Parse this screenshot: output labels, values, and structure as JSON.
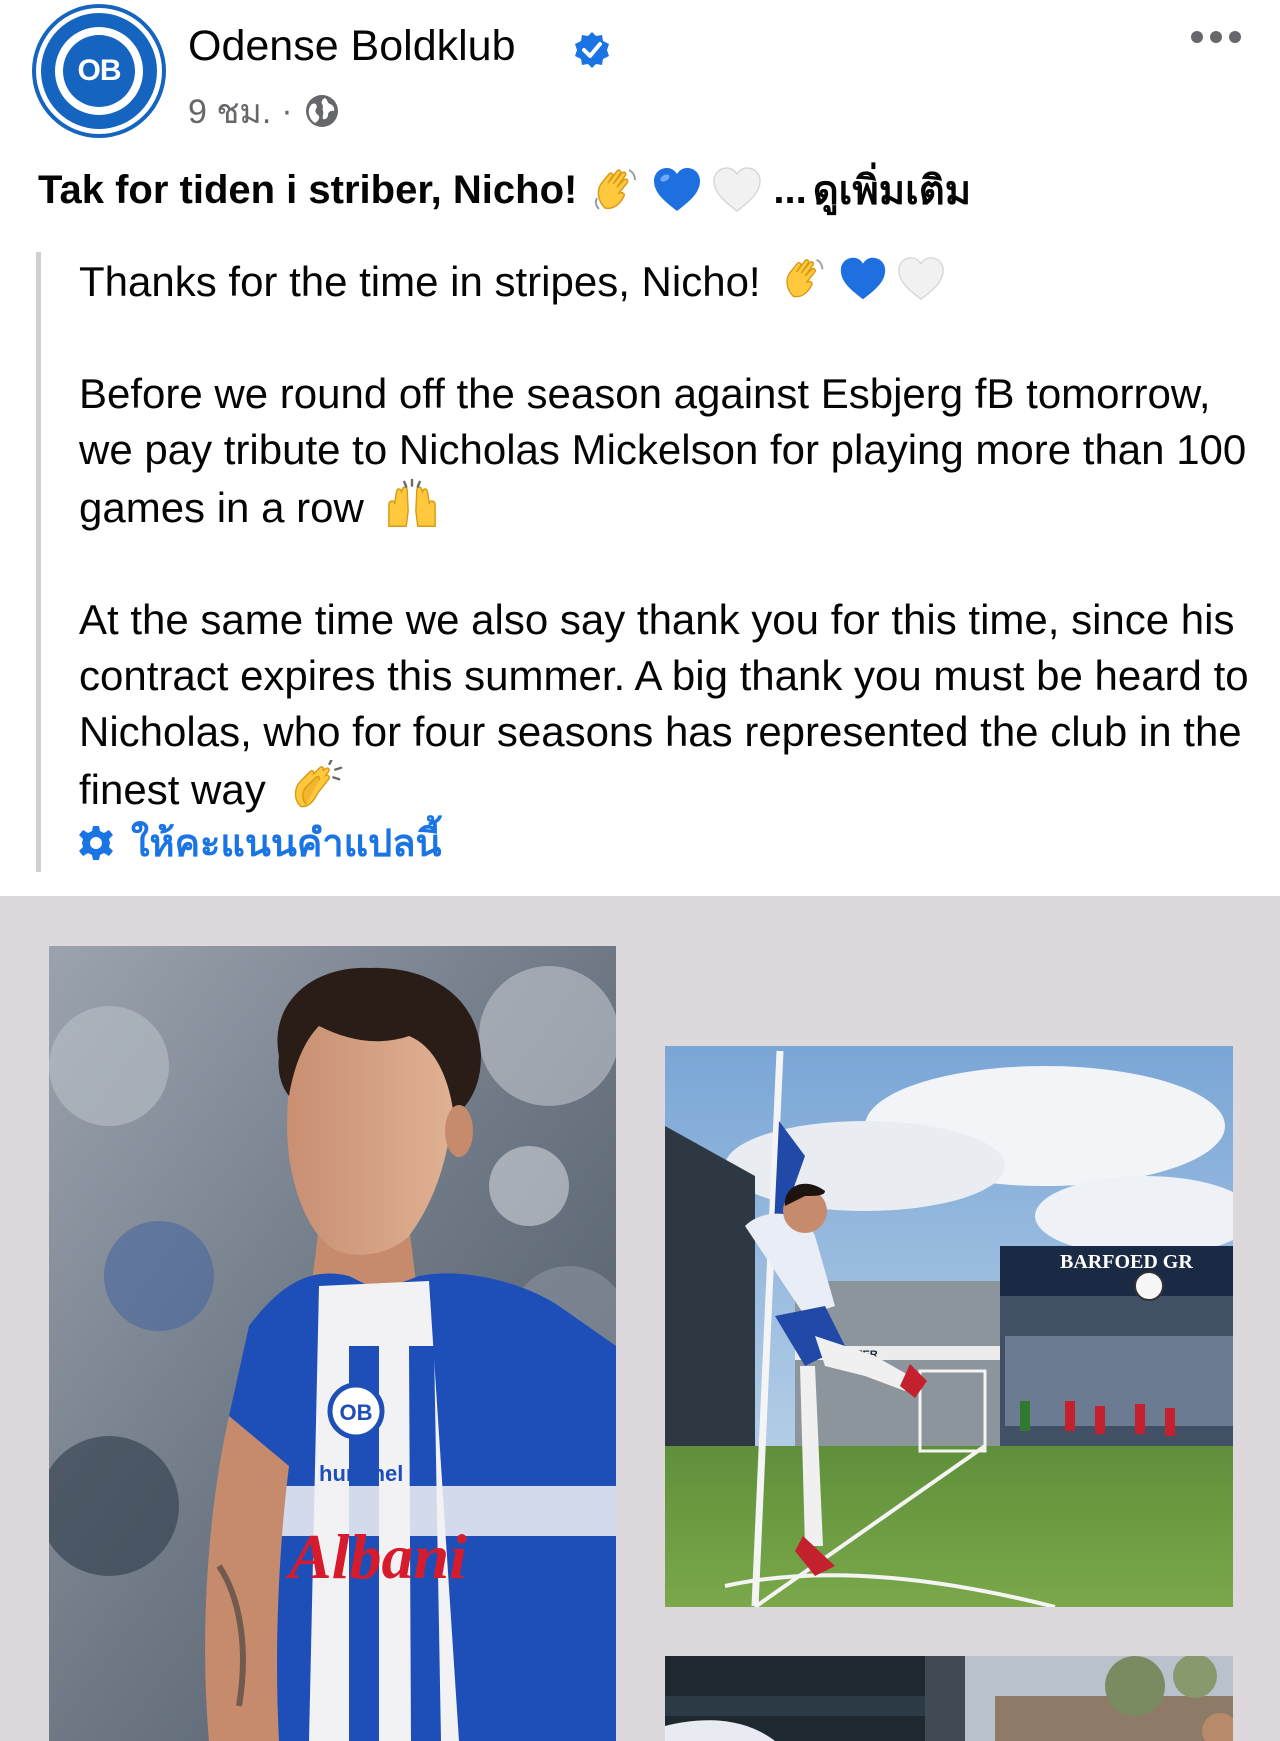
{
  "header": {
    "avatar_text": "OB",
    "page_name": "Odense Boldklub",
    "timestamp": "9 ชม.",
    "separator": "·",
    "privacy_icon": "globe-icon",
    "verified_icon": "verified-badge-icon",
    "more_icon": "more-options-icon"
  },
  "post": {
    "title": "Tak for tiden i striber, Nicho!",
    "title_emojis": [
      "waving-hand-icon",
      "blue-heart-icon",
      "white-heart-icon"
    ],
    "ellipsis": "...",
    "see_more": "ดูเพิ่มเติม"
  },
  "translation": {
    "line1": "Thanks for the time in stripes, Nicho!",
    "para2": "Before we round off the season against Esbjerg fB tomorrow, we pay tribute to Nicholas Mickelson for playing more than 100 games in a row",
    "para3": "At the same time we also say thank you for this time, since his contract expires this summer. A big thank you must be heard to Nicholas, who for four seasons has represented the club in the finest way",
    "rate_label": "ให้คะแนนคำแปลนี้"
  },
  "photos": {
    "jersey_text": "Albani",
    "sponsor_text": "hummel",
    "badge_text": "OB",
    "stand_sign": "BARFOED GR",
    "board_sign": "AV-CENTER"
  },
  "colors": {
    "accent": "#1b74e4",
    "club_blue": "#1565c0",
    "muted": "#65676b",
    "photo_bg": "#dcd8db"
  }
}
